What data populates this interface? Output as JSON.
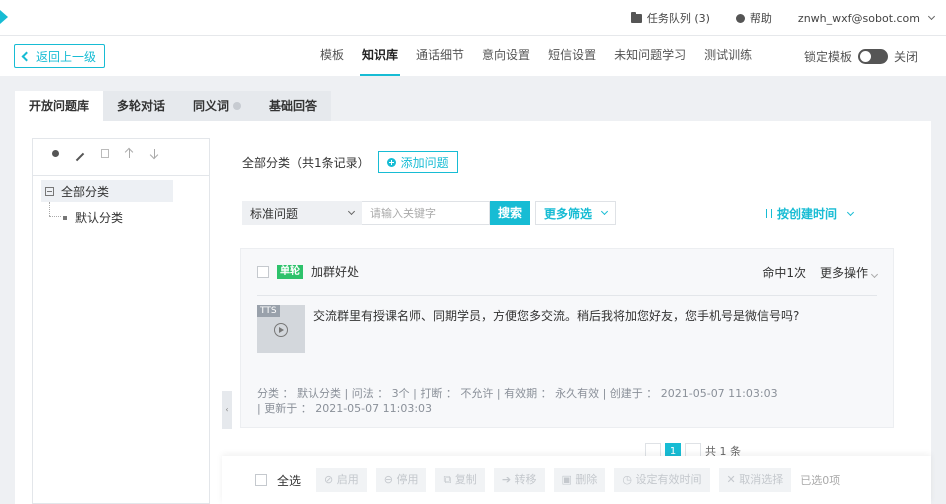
{
  "topbar": {
    "task_queue": "任务队列 (3)",
    "help": "帮助",
    "account": "znwh_wxf@sobot.com"
  },
  "nav": {
    "back": "返回上一级",
    "tabs": [
      "模板",
      "知识库",
      "通话细节",
      "意向设置",
      "短信设置",
      "未知问题学习",
      "测试训练"
    ],
    "active_tab": "知识库",
    "lock_label": "锁定模板",
    "lock_state": "关闭"
  },
  "subtabs": [
    "开放问题库",
    "多轮对话",
    "同义词",
    "基础回答"
  ],
  "tree": {
    "root": "全部分类",
    "child": "默认分类"
  },
  "list": {
    "summary": "全部分类（共1条记录）",
    "add_button": "添加问题",
    "filter_type": "标准问题",
    "keyword_placeholder": "请输入关键字",
    "search_button": "搜索",
    "more_filter": "更多筛选",
    "sort_label": "按创建时间"
  },
  "card": {
    "badge": "单轮",
    "title": "加群好处",
    "hits": "命中1次",
    "more_ops": "更多操作",
    "tts_label": "TTS",
    "answer": "交流群里有授课名师、同期学员，方便您多交流。稍后我将加您好友，您手机号是微信号吗?",
    "meta_line1": "分类 ： 默认分类 | 问法 ： 3个 | 打断 ： 不允许 | 有效期 ： 永久有效 | 创建于 ： 2021-05-07 11:03:03",
    "meta_line2": "| 更新于 ： 2021-05-07 11:03:03"
  },
  "pager": {
    "current": "1",
    "info": "共 1 条"
  },
  "bottom": {
    "select_all": "全选",
    "buttons": [
      "启用",
      "停用",
      "复制",
      "转移",
      "删除",
      "设定有效时间",
      "取消选择"
    ],
    "selected_count": "已选0项"
  },
  "colors": {
    "accent": "#17bcd4",
    "badge": "#2dc26b"
  }
}
